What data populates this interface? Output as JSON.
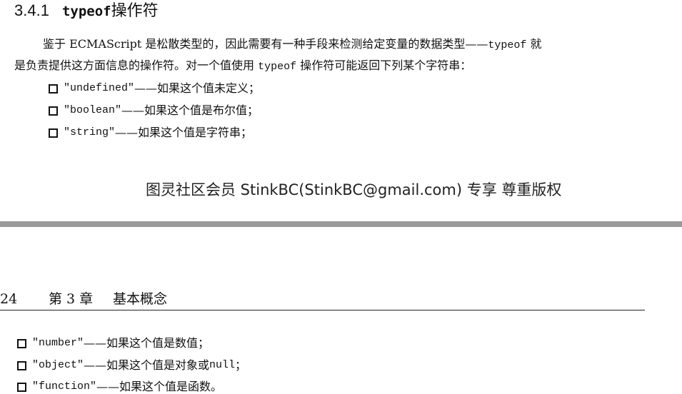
{
  "section": {
    "number": "3.4.1",
    "code": "typeof",
    "title_suffix": "操作符"
  },
  "paragraph": {
    "line1_text": "鉴于 ECMAScript 是松散类型的，因此需要有一种手段来检测给定变量的数据类型——",
    "line1_code": "typeof",
    "line1_end": " 就",
    "line2_start": "是负责提供这方面信息的操作符。对一个值使用 ",
    "line2_code": "typeof",
    "line2_end": " 操作符可能返回下列某个字符串："
  },
  "bullets_top": [
    {
      "code": "\"undefined\"",
      "text": "——如果这个值未定义；"
    },
    {
      "code": "\"boolean\"",
      "text": "——如果这个值是布尔值；"
    },
    {
      "code": "\"string\"",
      "text": "——如果这个值是字符串；"
    }
  ],
  "watermark": "图灵社区会员 StinkBC(StinkBC@gmail.com) 专享 尊重版权",
  "page_header": {
    "page_number": "24",
    "chapter": "第 3 章",
    "chapter_title": "基本概念"
  },
  "bullets_bottom": [
    {
      "code": "\"number\"",
      "text": "——如果这个值是数值；"
    },
    {
      "code": "\"object\"",
      "text": "——如果这个值是对象或 ",
      "code2": "null",
      "text2": "；"
    },
    {
      "code": "\"function\"",
      "text": "——如果这个值是函数。"
    }
  ]
}
